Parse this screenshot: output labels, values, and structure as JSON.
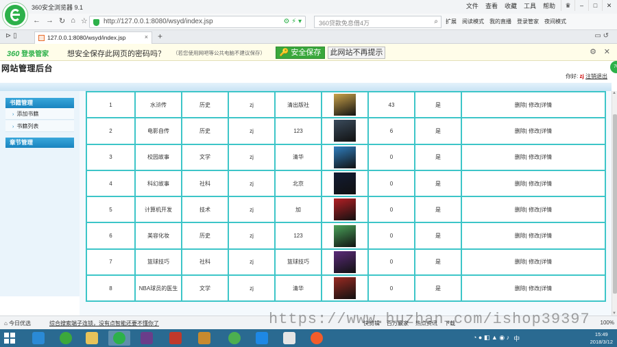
{
  "browser": {
    "title": "360安全浏览器 9.1",
    "menus": [
      "文件",
      "查看",
      "收藏",
      "工具",
      "帮助"
    ],
    "url": "http://127.0.0.1:8080/wsyd/index.jsp",
    "search_placeholder": "360贷款免息借4万",
    "tools": [
      "扩展",
      "阅读模式",
      "我的直播",
      "登录管家",
      "夜间模式"
    ],
    "tab_title": "127.0.0.1:8080/wsyd/index.jsp",
    "accent_color": "#2db14a"
  },
  "password_bar": {
    "brand": "360",
    "brand_suffix": "登录管家",
    "question": "想安全保存此网页的密码吗？",
    "note": "（若您使用网吧等公共电脑不建议保存）",
    "save_label": "安全保存",
    "never_label": "此网站不再提示"
  },
  "site": {
    "title": "网站管理后台",
    "greeting": "你好:",
    "username": "zj",
    "logout": "注销退出",
    "side_badge": "70"
  },
  "sidebar": {
    "sections": [
      {
        "title": "书籍管理",
        "items": [
          "添加书籍",
          "书籍列表"
        ]
      },
      {
        "title": "章节管理",
        "items": []
      }
    ]
  },
  "table": {
    "rows": [
      {
        "id": "1",
        "name": "水浒传",
        "category": "历史",
        "author": "zj",
        "publisher": "清出版社",
        "cover": "#c9a24a",
        "views": "43",
        "status": "是",
        "actions": "删除| 修改|详情"
      },
      {
        "id": "2",
        "name": "电影自传",
        "category": "历史",
        "author": "zj",
        "publisher": "123",
        "cover": "#3a4b5c",
        "views": "6",
        "status": "是",
        "actions": "删除| 修改|详情"
      },
      {
        "id": "3",
        "name": "校园故事",
        "category": "文学",
        "author": "zj",
        "publisher": "清华",
        "cover": "#2f7fbf",
        "views": "0",
        "status": "是",
        "actions": "删除| 修改|详情"
      },
      {
        "id": "4",
        "name": "科幻故事",
        "category": "社科",
        "author": "zj",
        "publisher": "北京",
        "cover": "#121c34",
        "views": "0",
        "status": "是",
        "actions": "删除| 修改|详情"
      },
      {
        "id": "5",
        "name": "计算机开发",
        "category": "技术",
        "author": "zj",
        "publisher": "加",
        "cover": "#b41f24",
        "views": "0",
        "status": "是",
        "actions": "删除| 修改|详情"
      },
      {
        "id": "6",
        "name": "美容化妆",
        "category": "历史",
        "author": "zj",
        "publisher": "123",
        "cover": "#4aa35a",
        "views": "0",
        "status": "是",
        "actions": "删除| 修改|详情"
      },
      {
        "id": "7",
        "name": "篮球技巧",
        "category": "社科",
        "author": "zj",
        "publisher": "篮球技巧",
        "cover": "#5b2b7a",
        "views": "0",
        "status": "是",
        "actions": "删除| 修改|详情"
      },
      {
        "id": "8",
        "name": "NBA球员的医生",
        "category": "文学",
        "author": "zj",
        "publisher": "清华",
        "cover": "#9a2a22",
        "views": "0",
        "status": "是",
        "actions": "删除| 修改|详情"
      }
    ]
  },
  "statusbar": {
    "left": "今日优选",
    "news": "综合搜索端子连锁，没有点智能还要不懂你了",
    "watermark": "https://www.huzhan.com/ishop39397",
    "items": [
      "快剪辑",
      "百万赢家",
      "热点资讯",
      "下载"
    ],
    "zoom": "100%"
  },
  "taskbar": {
    "time": "15:49",
    "date": "2018/3/12",
    "ime": "中"
  }
}
